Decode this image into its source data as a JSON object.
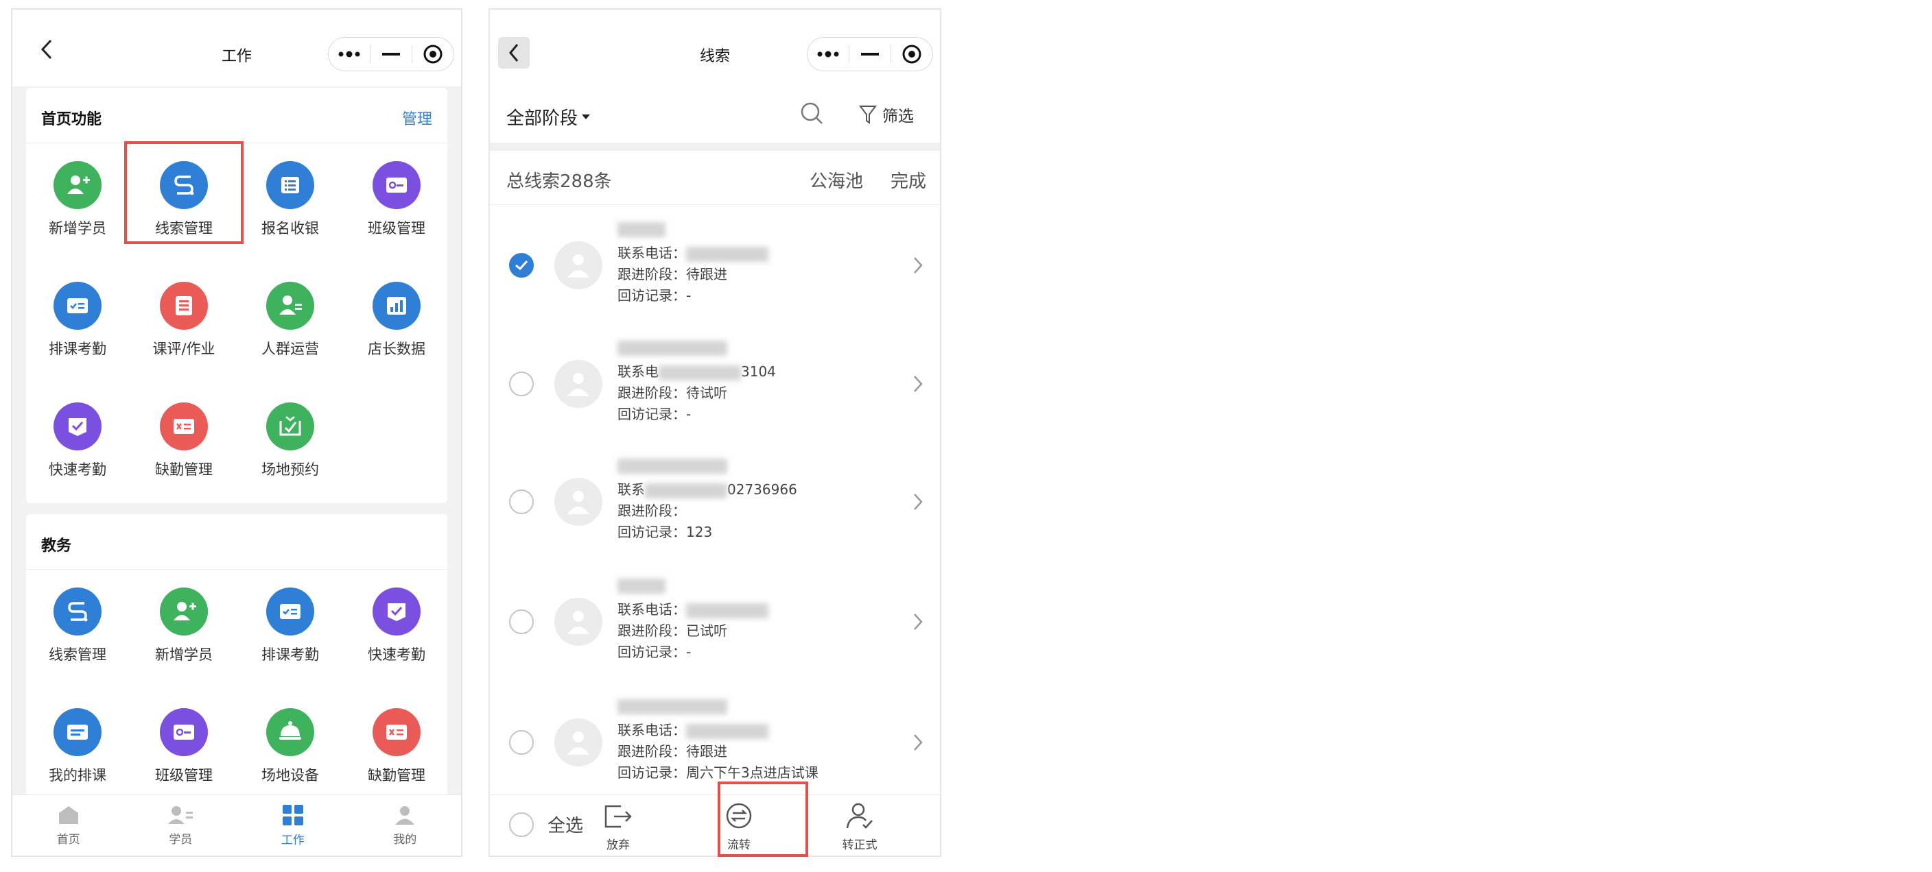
{
  "left": {
    "nav_title": "工作",
    "section1": {
      "title": "首页功能",
      "manage": "管理",
      "items": [
        {
          "label": "新增学员",
          "icon": "add-student-icon",
          "color": "#3fb25d"
        },
        {
          "label": "线索管理",
          "icon": "leads-icon",
          "color": "#2f7fd6"
        },
        {
          "label": "报名收银",
          "icon": "cashier-icon",
          "color": "#2f7fd6"
        },
        {
          "label": "班级管理",
          "icon": "class-card-icon",
          "color": "#7b4fe0"
        },
        {
          "label": "排课考勤",
          "icon": "schedule-icon",
          "color": "#2f7fd6"
        },
        {
          "label": "课评/作业",
          "icon": "homework-icon",
          "color": "#ea5b57"
        },
        {
          "label": "人群运营",
          "icon": "crowd-icon",
          "color": "#3fb25d"
        },
        {
          "label": "店长数据",
          "icon": "data-chart-icon",
          "color": "#2f7fd6"
        },
        {
          "label": "快速考勤",
          "icon": "quick-attendance-icon",
          "color": "#7b4fe0"
        },
        {
          "label": "缺勤管理",
          "icon": "absence-icon",
          "color": "#ea5b57"
        },
        {
          "label": "场地预约",
          "icon": "venue-booking-icon",
          "color": "#3fb25d"
        }
      ]
    },
    "section2": {
      "title": "教务",
      "items": [
        {
          "label": "线索管理",
          "icon": "leads-icon",
          "color": "#2f7fd6"
        },
        {
          "label": "新增学员",
          "icon": "add-student-icon",
          "color": "#3fb25d"
        },
        {
          "label": "排课考勤",
          "icon": "schedule-icon",
          "color": "#2f7fd6"
        },
        {
          "label": "快速考勤",
          "icon": "quick-attendance-icon",
          "color": "#7b4fe0"
        },
        {
          "label": "我的排课",
          "icon": "my-schedule-icon",
          "color": "#2f7fd6"
        },
        {
          "label": "班级管理",
          "icon": "class-card-icon",
          "color": "#7b4fe0"
        },
        {
          "label": "场地设备",
          "icon": "venue-equipment-icon",
          "color": "#3fb25d"
        },
        {
          "label": "缺勤管理",
          "icon": "absence-icon",
          "color": "#ea5b57"
        }
      ]
    },
    "tabs": [
      {
        "label": "首页",
        "icon": "home-icon"
      },
      {
        "label": "学员",
        "icon": "students-icon"
      },
      {
        "label": "工作",
        "icon": "work-grid-icon",
        "active": true
      },
      {
        "label": "我的",
        "icon": "profile-icon"
      }
    ]
  },
  "right": {
    "nav_title": "线索",
    "stage_filter": "全部阶段",
    "filter_label": "筛选",
    "total": "总线索288条",
    "pool": "公海池",
    "done": "完成",
    "leads": [
      {
        "phone_label": "联系电话：",
        "phone": "",
        "stage_label": "跟进阶段：",
        "stage": "待跟进",
        "visit_label": "回访记录：",
        "visit": "-",
        "checked": true
      },
      {
        "phone_label": "联系电",
        "phone": "3104",
        "stage_label": "跟进阶段：",
        "stage": "待试听",
        "visit_label": "回访记录：",
        "visit": "-",
        "checked": false
      },
      {
        "phone_label": "联系",
        "phone": "02736966",
        "stage_label": "跟进阶段：",
        "stage": "",
        "visit_label": "回访记录：",
        "visit": "123",
        "checked": false
      },
      {
        "phone_label": "联系电话：",
        "phone": "",
        "stage_label": "跟进阶段：",
        "stage": "已试听",
        "visit_label": "回访记录：",
        "visit": "-",
        "checked": false
      },
      {
        "phone_label": "联系电话：",
        "phone": "",
        "stage_label": "跟进阶段：",
        "stage": "待跟进",
        "visit_label": "回访记录：",
        "visit": "周六下午3点进店试课",
        "checked": false
      }
    ],
    "select_all": "全选",
    "actions": [
      {
        "label": "放弃",
        "icon": "abandon-icon"
      },
      {
        "label": "流转",
        "icon": "transfer-icon"
      },
      {
        "label": "转正式",
        "icon": "convert-formal-icon"
      }
    ]
  }
}
